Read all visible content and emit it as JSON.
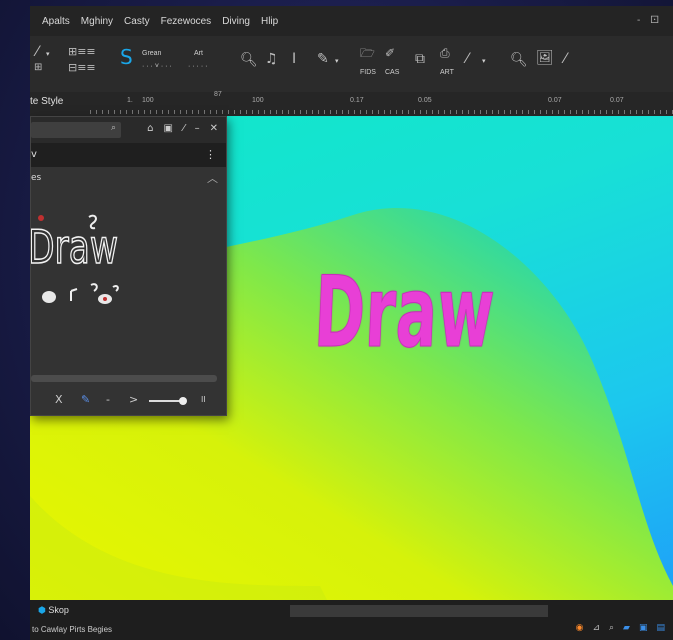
{
  "menu": [
    "Apalts",
    "Mghiny",
    "Casty",
    "Fezewoces",
    "Diving",
    "Hlip"
  ],
  "window_controls": [
    "-",
    "⚀"
  ],
  "toolbar": {
    "group_label_1": "Grean",
    "group_label_2": "Art",
    "file_label_1": "FIDS",
    "file_label_2": "CAS",
    "file_label_3": "ART"
  },
  "ruler": {
    "style_label": "te Style",
    "ticks": [
      "1.",
      "100",
      "87",
      "100",
      "0.17",
      "0.05",
      "0.07",
      "0.07"
    ]
  },
  "canvas": {
    "title_text": "Draw",
    "text_color": "#e83fd6"
  },
  "panel": {
    "row_label": "v",
    "section_label": "es",
    "thumb_text": "Draw",
    "controls": [
      "X",
      "-",
      ">",
      "II"
    ]
  },
  "status": {
    "task_label": "Skop",
    "status_text": "to Cawlay Pirts Begies"
  },
  "colors": {
    "accent": "#1aa6e8",
    "canvas_magenta": "#e83fd6"
  }
}
